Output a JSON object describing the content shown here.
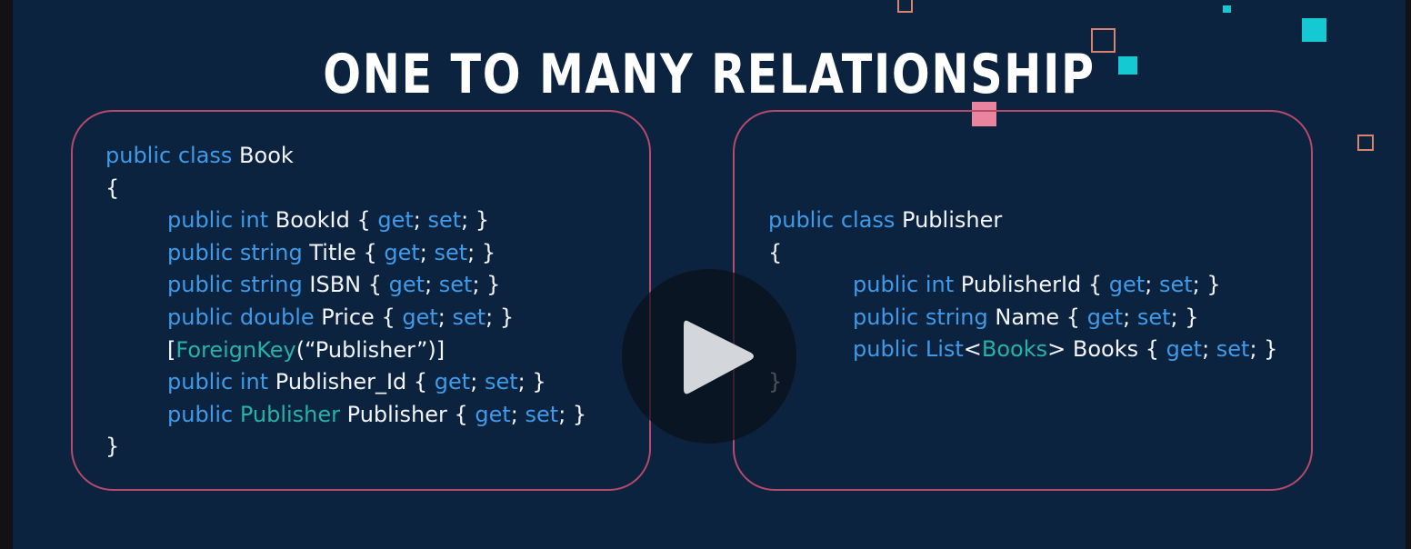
{
  "title": "ONE TO MANY RELATIONSHIP",
  "book_class": {
    "lines": [
      [
        {
          "t": "public class ",
          "c": "kw"
        },
        {
          "t": "Book",
          "c": "pl"
        }
      ],
      [
        {
          "t": "{",
          "c": "pl"
        }
      ],
      [
        {
          "t": "public int ",
          "c": "kw"
        },
        {
          "t": "BookId { ",
          "c": "pl"
        },
        {
          "t": "get",
          "c": "kw"
        },
        {
          "t": "; ",
          "c": "pl"
        },
        {
          "t": "set",
          "c": "kw"
        },
        {
          "t": "; }",
          "c": "pl"
        }
      ],
      [
        {
          "t": "public string ",
          "c": "kw"
        },
        {
          "t": "Title { ",
          "c": "pl"
        },
        {
          "t": "get",
          "c": "kw"
        },
        {
          "t": "; ",
          "c": "pl"
        },
        {
          "t": "set",
          "c": "kw"
        },
        {
          "t": "; }",
          "c": "pl"
        }
      ],
      [
        {
          "t": "public string ",
          "c": "kw"
        },
        {
          "t": "ISBN { ",
          "c": "pl"
        },
        {
          "t": "get",
          "c": "kw"
        },
        {
          "t": "; ",
          "c": "pl"
        },
        {
          "t": "set",
          "c": "kw"
        },
        {
          "t": "; }",
          "c": "pl"
        }
      ],
      [
        {
          "t": "public double ",
          "c": "kw"
        },
        {
          "t": "Price { ",
          "c": "pl"
        },
        {
          "t": "get",
          "c": "kw"
        },
        {
          "t": "; ",
          "c": "pl"
        },
        {
          "t": "set",
          "c": "kw"
        },
        {
          "t": "; }",
          "c": "pl"
        }
      ],
      [
        {
          "t": "[",
          "c": "pl"
        },
        {
          "t": "ForeignKey",
          "c": "ty"
        },
        {
          "t": "(“Publisher”)]",
          "c": "pl"
        }
      ],
      [
        {
          "t": "public int ",
          "c": "kw"
        },
        {
          "t": "Publisher_Id { ",
          "c": "pl"
        },
        {
          "t": "get",
          "c": "kw"
        },
        {
          "t": "; ",
          "c": "pl"
        },
        {
          "t": "set",
          "c": "kw"
        },
        {
          "t": "; }",
          "c": "pl"
        }
      ],
      [
        {
          "t": "public ",
          "c": "kw"
        },
        {
          "t": "Publisher ",
          "c": "ty"
        },
        {
          "t": "Publisher { ",
          "c": "pl"
        },
        {
          "t": "get",
          "c": "kw"
        },
        {
          "t": "; ",
          "c": "pl"
        },
        {
          "t": "set",
          "c": "kw"
        },
        {
          "t": "; }",
          "c": "pl"
        }
      ],
      [
        {
          "t": "}",
          "c": "pl"
        }
      ]
    ]
  },
  "publisher_class": {
    "lines": [
      [
        {
          "t": "public class ",
          "c": "kw"
        },
        {
          "t": "Publisher",
          "c": "pl"
        }
      ],
      [
        {
          "t": "{",
          "c": "pl"
        }
      ],
      [
        {
          "t": "public int ",
          "c": "kw"
        },
        {
          "t": "PublisherId { ",
          "c": "pl"
        },
        {
          "t": "get",
          "c": "kw"
        },
        {
          "t": "; ",
          "c": "pl"
        },
        {
          "t": "set",
          "c": "kw"
        },
        {
          "t": "; }",
          "c": "pl"
        }
      ],
      [
        {
          "t": "public string ",
          "c": "kw"
        },
        {
          "t": "Name { ",
          "c": "pl"
        },
        {
          "t": "get",
          "c": "kw"
        },
        {
          "t": "; ",
          "c": "pl"
        },
        {
          "t": "set",
          "c": "kw"
        },
        {
          "t": "; }",
          "c": "pl"
        }
      ],
      [
        {
          "t": "public List",
          "c": "kw"
        },
        {
          "t": "<",
          "c": "pl"
        },
        {
          "t": "Books",
          "c": "ty"
        },
        {
          "t": "> Books { ",
          "c": "pl"
        },
        {
          "t": "get",
          "c": "kw"
        },
        {
          "t": "; ",
          "c": "pl"
        },
        {
          "t": "set",
          "c": "kw"
        },
        {
          "t": "; }",
          "c": "pl"
        }
      ],
      [
        {
          "t": "}",
          "c": "pl"
        }
      ]
    ]
  },
  "play_button": {
    "icon": "play-icon"
  },
  "colors": {
    "background": "#0c2340",
    "keyword": "#3f9ae8",
    "type": "#27b3a3",
    "text": "#f2f4f8",
    "card_border": "#b54a6a",
    "accent_cyan": "#14c9d2",
    "accent_pink": "#e8849e"
  }
}
